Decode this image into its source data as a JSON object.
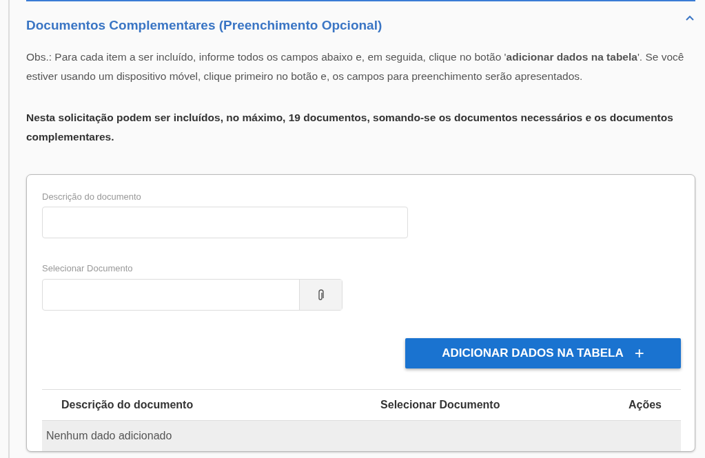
{
  "section": {
    "title": "Documentos Complementares (Preenchimento Opcional)",
    "expanded": true,
    "note": "Obs.: Para cada item a ser incluído, informe todos os campos abaixo e, em seguida, clique no botão '**adicionar dados na tabela**'. Se você estiver usando um dispositivo móvel, clique primeiro no botão e, os campos para preenchimento serão apresentados.",
    "limit": "Nesta solicitação podem ser incluídos, no máximo, 19 documentos, somando-se os documentos necessários e os documentos complementares."
  },
  "form": {
    "description_label": "Descrição do documento",
    "file_label": "Selecionar Documento",
    "add_button": "ADICIONAR DADOS NA TABELA",
    "add_icon": "+"
  },
  "table": {
    "columns": [
      "Descrição do documento",
      "Selecionar Documento",
      "Ações"
    ],
    "empty": "Nenhum dado adicionado"
  }
}
